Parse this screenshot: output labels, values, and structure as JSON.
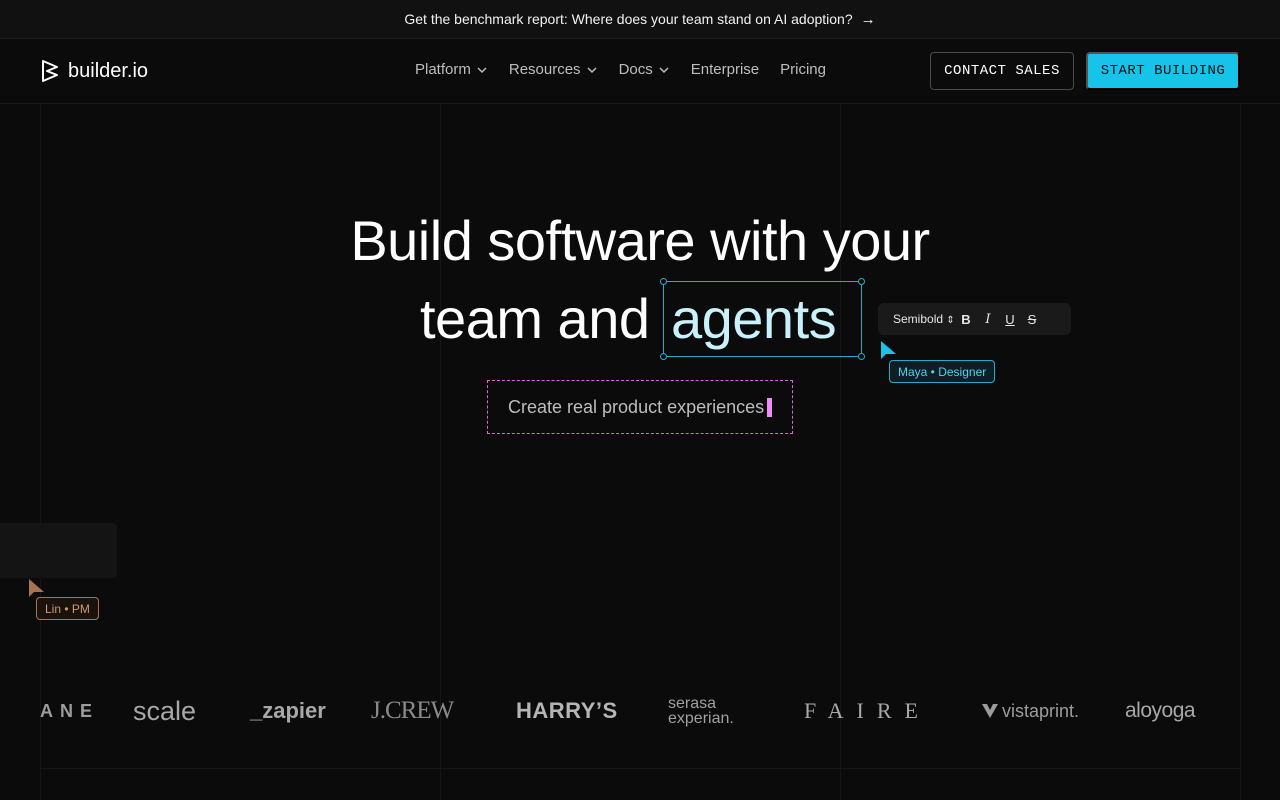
{
  "banner": {
    "text": "Get the benchmark report: Where does your team stand on AI adoption?",
    "arrow": "→"
  },
  "nav": {
    "logo_text": "builder.io",
    "menu": [
      {
        "label": "Platform",
        "has_dropdown": true
      },
      {
        "label": "Resources",
        "has_dropdown": true
      },
      {
        "label": "Docs",
        "has_dropdown": true
      },
      {
        "label": "Enterprise",
        "has_dropdown": false
      },
      {
        "label": "Pricing",
        "has_dropdown": false
      }
    ],
    "contact_sales": "CONTACT SALES",
    "start_building": "START BUILDING"
  },
  "hero": {
    "line1": "Build software with your",
    "line2_prefix": "team and",
    "highlight_word": "agents",
    "subtitle": "Create real product experiences"
  },
  "format_toolbar": {
    "font_weight": "Semibold",
    "weight_arrows": "⇕",
    "bold": "B",
    "italic": "I",
    "underline": "U",
    "strike": "S"
  },
  "collaborators": {
    "designer_tag": "Maya • Designer",
    "pm_tag": "Lin • PM"
  },
  "logos": {
    "ane": "ANE",
    "scale": "scale",
    "zapier": "_zapier",
    "jcrew": "J.CREW",
    "harrys": "HARRY’S",
    "serasa_top": "serasa",
    "serasa_bottom": "experian.",
    "faire": "FAIRE",
    "vistaprint": "vistaprint.",
    "aloyoga": "aloyoga"
  },
  "colors": {
    "background": "#0b0b0b",
    "accent_cyan": "#18c3ea",
    "selection_pink": "#d46ad8",
    "pm_brown": "#a9734f"
  }
}
